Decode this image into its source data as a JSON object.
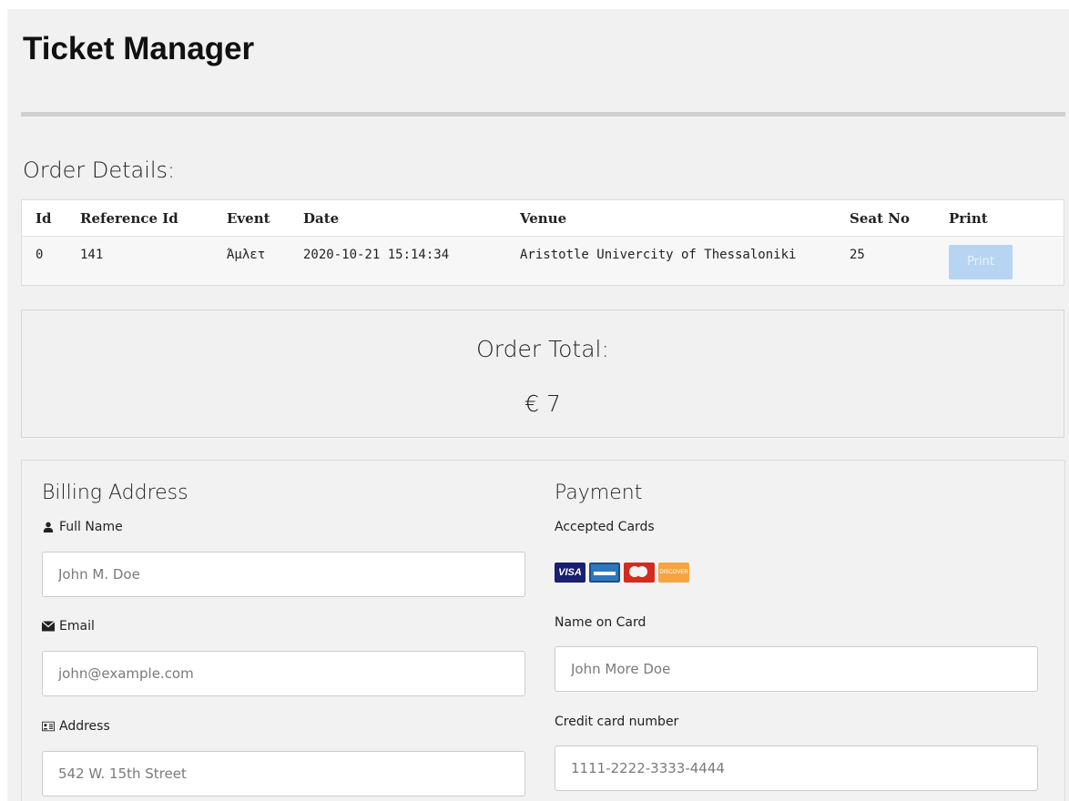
{
  "app": {
    "title": "Ticket Manager"
  },
  "order_details": {
    "title": "Order Details:",
    "columns": [
      "Id",
      "Reference Id",
      "Event",
      "Date",
      "Venue",
      "Seat No",
      "Print"
    ],
    "rows": [
      {
        "id": "0",
        "reference_id": "141",
        "event": "Άμλετ",
        "date": "2020-10-21 15:14:34",
        "venue": "Aristotle Univercity of Thessaloniki",
        "seat_no": "25",
        "print_label": "Print"
      }
    ]
  },
  "order_total": {
    "label": "Order Total:",
    "amount": "€ 7"
  },
  "billing": {
    "title": "Billing Address",
    "full_name": {
      "label": "Full Name",
      "placeholder": "John M. Doe",
      "icon": "user-icon"
    },
    "email": {
      "label": "Email",
      "placeholder": "john@example.com",
      "icon": "envelope-icon"
    },
    "address": {
      "label": "Address",
      "placeholder": "542 W. 15th Street",
      "icon": "address-card-icon"
    }
  },
  "payment": {
    "title": "Payment",
    "accepted_cards_label": "Accepted Cards",
    "cards": [
      "visa",
      "amex",
      "mastercard",
      "discover"
    ],
    "visa_text": "VISA",
    "discover_text": "DISCOVER",
    "name_on_card": {
      "label": "Name on Card",
      "placeholder": "John More Doe"
    },
    "card_number": {
      "label": "Credit card number",
      "placeholder": "1111-2222-3333-4444"
    }
  },
  "colors": {
    "page_bg": "#f1f1f1",
    "print_button": "#b7d5f2",
    "divider": "#cfcfcf"
  }
}
